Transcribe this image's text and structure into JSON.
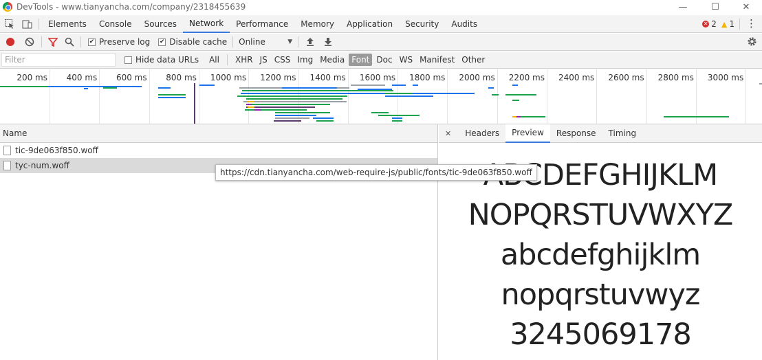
{
  "window": {
    "title": "DevTools - www.tianyancha.com/company/2318455639",
    "minimize": "—",
    "maximize": "☐",
    "close": "✕"
  },
  "toolbar": {
    "tabs": [
      "Elements",
      "Console",
      "Sources",
      "Network",
      "Performance",
      "Memory",
      "Application",
      "Security",
      "Audits"
    ],
    "active_tab": "Network",
    "error_count": "2",
    "warning_count": "1",
    "menu": "⋮"
  },
  "network_toolbar": {
    "preserve_log": "Preserve log",
    "disable_cache": "Disable cache",
    "throttle": "Online",
    "throttle_caret": "▼"
  },
  "filter": {
    "placeholder": "Filter",
    "hide_data_urls": "Hide data URLs",
    "types": [
      "All",
      "XHR",
      "JS",
      "CSS",
      "Img",
      "Media",
      "Font",
      "Doc",
      "WS",
      "Manifest",
      "Other"
    ],
    "selected_type": "Font"
  },
  "overview": {
    "ticks": [
      "200 ms",
      "400 ms",
      "600 ms",
      "800 ms",
      "1000 ms",
      "1200 ms",
      "1400 ms",
      "1600 ms",
      "1800 ms",
      "2000 ms",
      "2200 ms",
      "2400 ms",
      "2600 ms",
      "2800 ms",
      "3000 ms"
    ]
  },
  "requests": {
    "header": "Name",
    "rows": [
      "tic-9de063f850.woff",
      "tyc-num.woff"
    ],
    "selected_index": 1,
    "tooltip": "https://cdn.tianyancha.com/web-require-js/public/fonts/tic-9de063f850.woff"
  },
  "detail": {
    "close": "✕",
    "tabs": [
      "Headers",
      "Preview",
      "Response",
      "Timing"
    ],
    "active_tab": "Preview",
    "preview_lines": [
      "ABCDEFGHIJKLM",
      "NOPQRSTUVWXYZ",
      "abcdefghijklm",
      "nopqrstuvwyz",
      "3245069178"
    ]
  },
  "colors": {
    "accent": "#3879d9",
    "record": "#d32f2f",
    "filter_icon": "#d32f2f",
    "error": "#d32f2f",
    "warning": "#f4b400"
  }
}
